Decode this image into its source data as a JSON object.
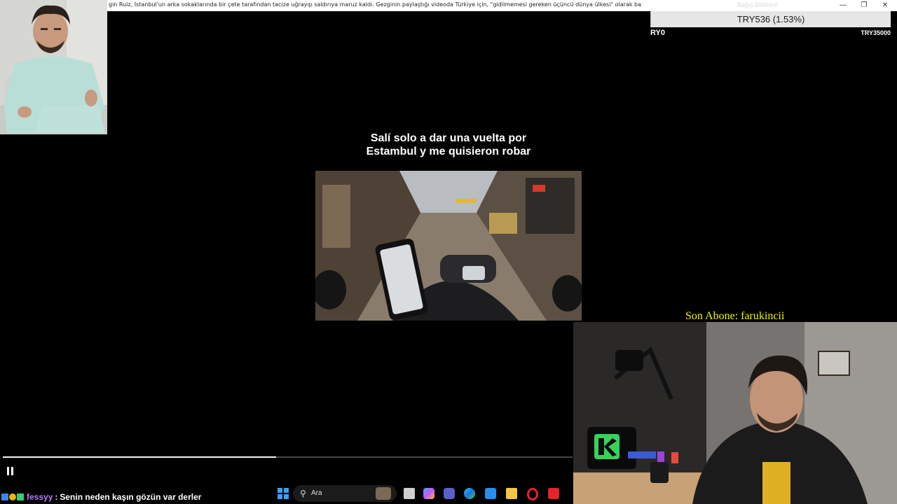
{
  "window": {
    "title": "gin Ruiz, İstanbul'un arka sokaklarında bir çete tarafından tacize uğrayıp saldırıya maruz kaldı. Gezginin paylaştığı videoda Türkiye için, \"gidilmemesi gereken üçüncü dünya ülkesi\" olarak bahsediliyor. Maalesef bu ti",
    "ghost_title": "Bağış Bildirimi",
    "controls": [
      "minimize-icon",
      "restore-icon",
      "close-icon"
    ]
  },
  "donation": {
    "amount": "TRY536 (1.53%)",
    "goal_left": "RY0",
    "goal_right": "TRY35000",
    "progress_fraction": 0.0153
  },
  "video": {
    "caption_line1": "Salí solo a dar una vuelta por",
    "caption_line2": "Estambul y me quisieron robar",
    "progress_fraction": 0.48
  },
  "overlay": {
    "last_subscriber": "Son Abone: farukincii"
  },
  "chat": {
    "username": "fessyy",
    "separator": ":",
    "message": "Senin neden kaşın gözün var derler",
    "username_color": "#b57bff"
  },
  "taskbar": {
    "search_placeholder": "Ara",
    "icons": [
      "windows-start-icon",
      "search-icon",
      "task-view-icon",
      "copilot-icon",
      "teams-icon",
      "edge-icon",
      "store-icon",
      "file-explorer-icon",
      "opera-icon",
      "app-icon"
    ]
  }
}
